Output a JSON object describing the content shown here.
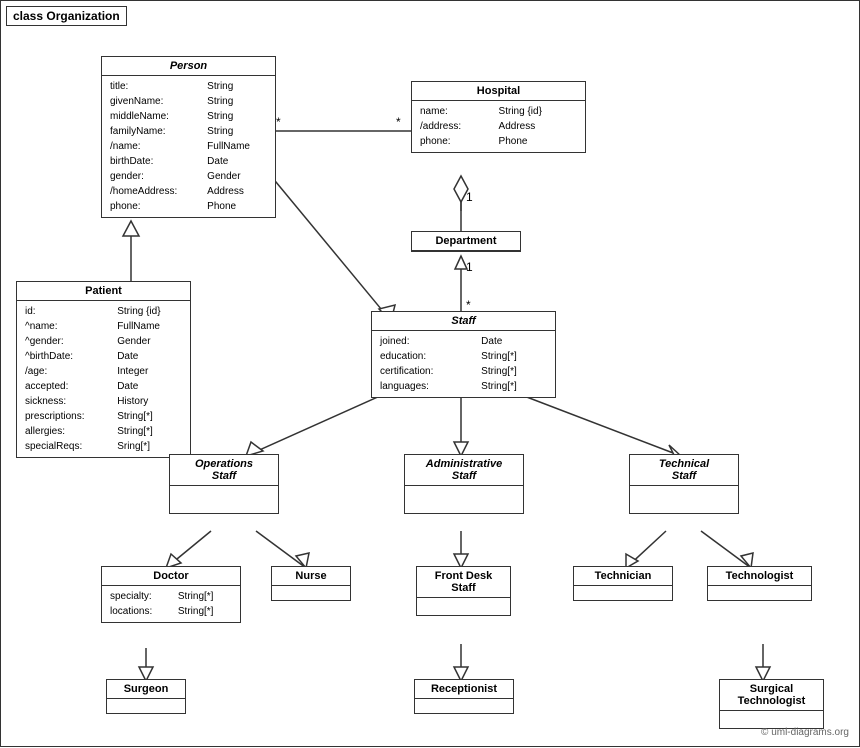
{
  "title": "class Organization",
  "copyright": "© uml-diagrams.org",
  "classes": {
    "person": {
      "name": "Person",
      "italic": true,
      "attributes": [
        [
          "title:",
          "String"
        ],
        [
          "givenName:",
          "String"
        ],
        [
          "middleName:",
          "String"
        ],
        [
          "familyName:",
          "String"
        ],
        [
          "/name:",
          "FullName"
        ],
        [
          "birthDate:",
          "Date"
        ],
        [
          "gender:",
          "Gender"
        ],
        [
          "/homeAddress:",
          "Address"
        ],
        [
          "phone:",
          "Phone"
        ]
      ]
    },
    "hospital": {
      "name": "Hospital",
      "italic": false,
      "attributes": [
        [
          "name:",
          "String {id}"
        ],
        [
          "/address:",
          "Address"
        ],
        [
          "phone:",
          "Phone"
        ]
      ]
    },
    "patient": {
      "name": "Patient",
      "italic": false,
      "attributes": [
        [
          "id:",
          "String {id}"
        ],
        [
          "^name:",
          "FullName"
        ],
        [
          "^gender:",
          "Gender"
        ],
        [
          "^birthDate:",
          "Date"
        ],
        [
          "/age:",
          "Integer"
        ],
        [
          "accepted:",
          "Date"
        ],
        [
          "sickness:",
          "History"
        ],
        [
          "prescriptions:",
          "String[*]"
        ],
        [
          "allergies:",
          "String[*]"
        ],
        [
          "specialReqs:",
          "Sring[*]"
        ]
      ]
    },
    "department": {
      "name": "Department",
      "italic": false,
      "attributes": []
    },
    "staff": {
      "name": "Staff",
      "italic": true,
      "attributes": [
        [
          "joined:",
          "Date"
        ],
        [
          "education:",
          "String[*]"
        ],
        [
          "certification:",
          "String[*]"
        ],
        [
          "languages:",
          "String[*]"
        ]
      ]
    },
    "operations_staff": {
      "name": "Operations\nStaff",
      "italic": true,
      "attributes": []
    },
    "administrative_staff": {
      "name": "Administrative\nStaff",
      "italic": true,
      "attributes": []
    },
    "technical_staff": {
      "name": "Technical\nStaff",
      "italic": true,
      "attributes": []
    },
    "doctor": {
      "name": "Doctor",
      "italic": false,
      "attributes": [
        [
          "specialty:",
          "String[*]"
        ],
        [
          "locations:",
          "String[*]"
        ]
      ]
    },
    "nurse": {
      "name": "Nurse",
      "italic": false,
      "attributes": []
    },
    "front_desk_staff": {
      "name": "Front Desk\nStaff",
      "italic": false,
      "attributes": []
    },
    "technician": {
      "name": "Technician",
      "italic": false,
      "attributes": []
    },
    "technologist": {
      "name": "Technologist",
      "italic": false,
      "attributes": []
    },
    "surgeon": {
      "name": "Surgeon",
      "italic": false,
      "attributes": []
    },
    "receptionist": {
      "name": "Receptionist",
      "italic": false,
      "attributes": []
    },
    "surgical_technologist": {
      "name": "Surgical\nTechnologist",
      "italic": false,
      "attributes": []
    }
  }
}
